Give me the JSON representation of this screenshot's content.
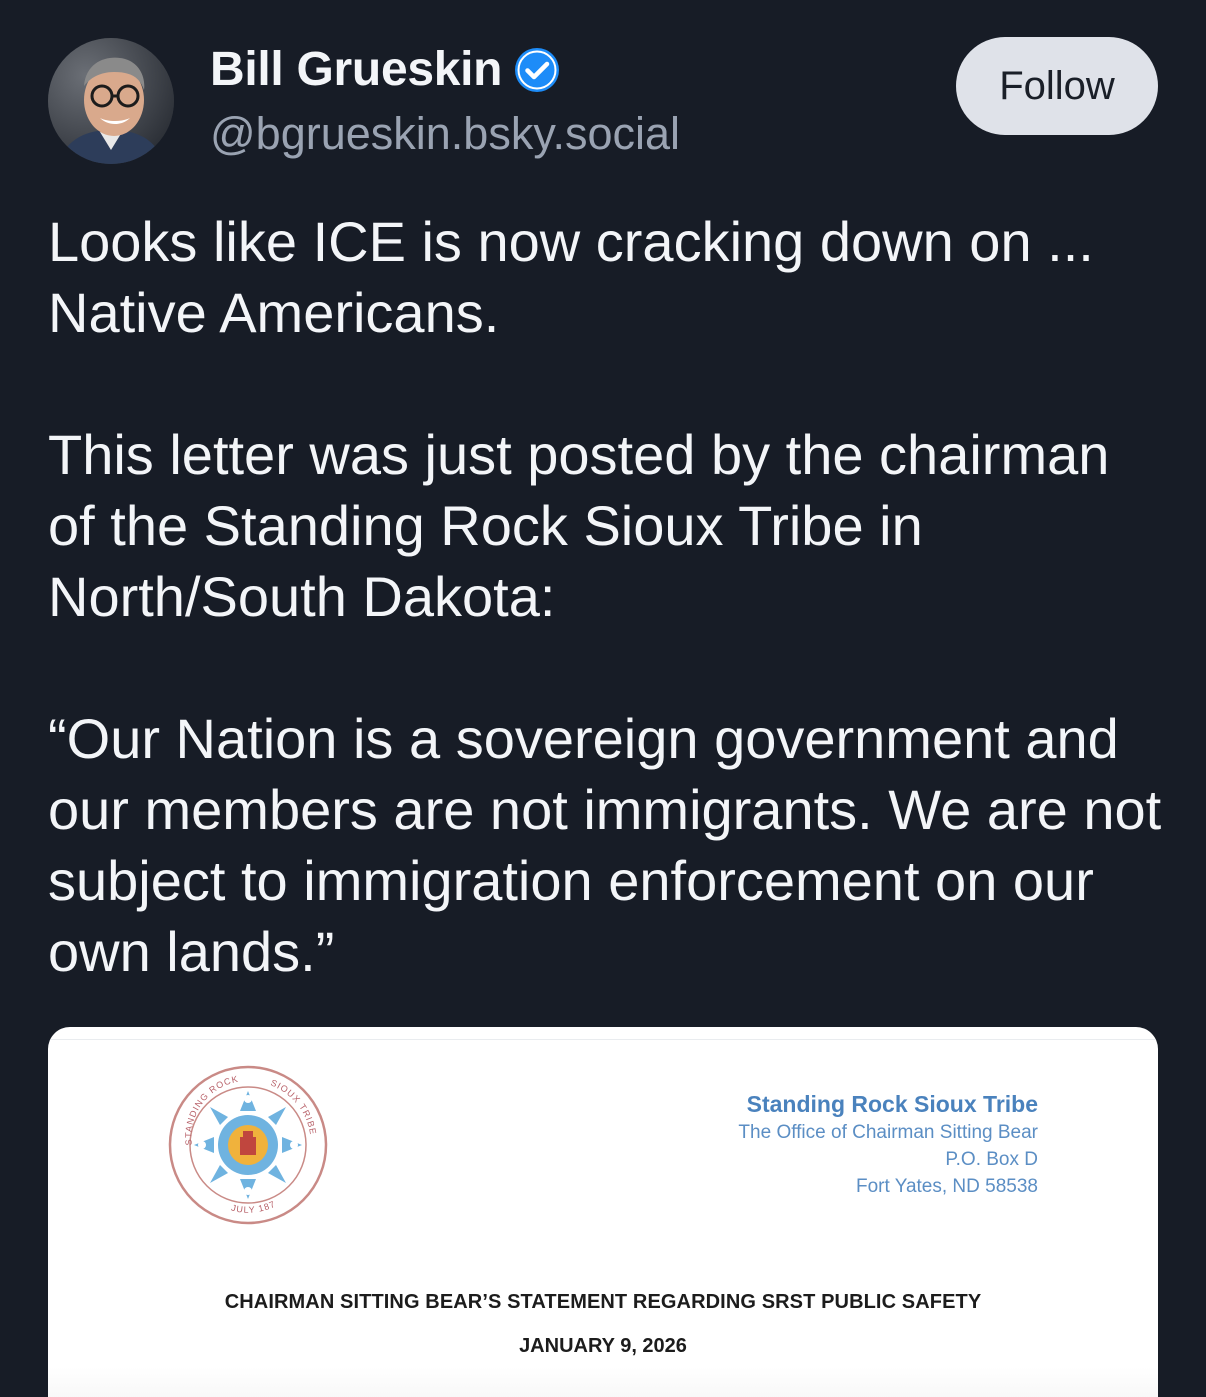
{
  "author": {
    "display_name": "Bill Grueskin",
    "handle": "@bgrueskin.bsky.social",
    "verified_icon": "verified-check-icon",
    "verified_color": "#1d8cf8"
  },
  "follow_button": {
    "label": "Follow"
  },
  "post": {
    "paragraph_1": "Looks like ICE is now cracking down on ... Native Americans.",
    "paragraph_2": "This letter was just posted by the chairman of the Standing Rock Sioux Tribe in North/South Dakota:",
    "paragraph_3": "“Our Nation is a sovereign government and our members are not immigrants. We are not subject to immigration enforcement on our own lands.”"
  },
  "letter": {
    "seal_text_top": "STANDING ROCK",
    "seal_text_right": "SIOUX TRIBE",
    "seal_text_bottom": "JULY 1873",
    "org_name": "Standing Rock Sioux Tribe",
    "office": "The Office of Chairman Sitting Bear",
    "po_box": "P.O. Box D",
    "city": "Fort Yates, ND 58538",
    "title": "CHAIRMAN SITTING BEAR’S STATEMENT REGARDING SRST PUBLIC SAFETY",
    "date": "JANUARY 9, 2026"
  },
  "colors": {
    "background": "#171c26",
    "follow_bg": "#dfe2e9",
    "letterhead_blue": "#4a82bd"
  }
}
